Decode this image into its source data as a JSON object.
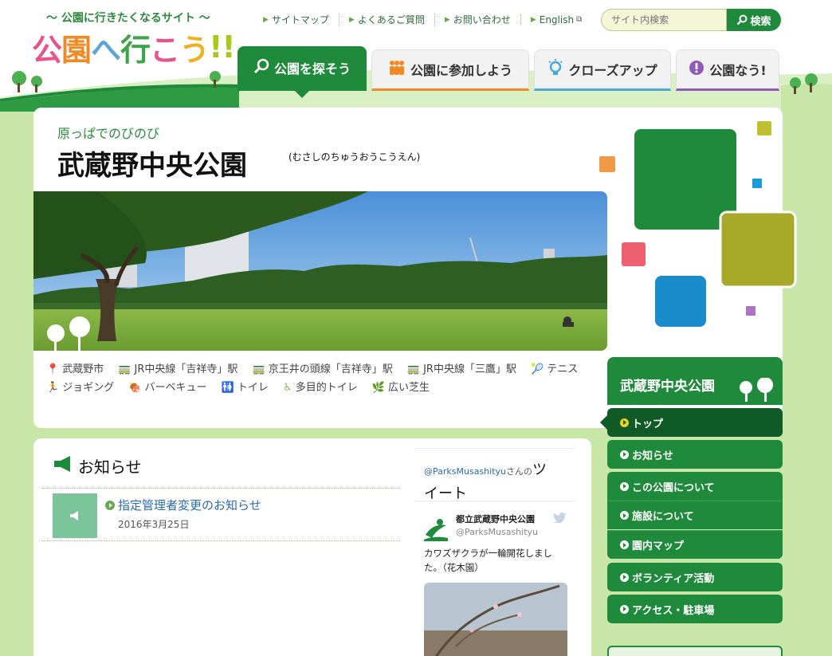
{
  "header": {
    "tagline": "〜 公園に行きたくなるサイト 〜",
    "logo_chars": [
      "公",
      "園",
      "へ",
      "行",
      "こ",
      "う",
      "!!"
    ],
    "util_links": [
      {
        "label": "サイトマップ"
      },
      {
        "label": "よくあるご質問"
      },
      {
        "label": "お問い合わせ"
      },
      {
        "label": "English",
        "external": true
      }
    ],
    "search": {
      "placeholder": "サイト内検索",
      "button": "検索"
    }
  },
  "main_nav": [
    {
      "label": "公園を探そう",
      "icon": "magnifier-icon",
      "active": true
    },
    {
      "label": "公園に参加しよう",
      "icon": "people-icon"
    },
    {
      "label": "クローズアップ",
      "icon": "lightbulb-icon"
    },
    {
      "label": "公園なう!",
      "icon": "exclamation-icon"
    }
  ],
  "park": {
    "catch": "原っぱでのびのび",
    "name": "武蔵野中央公園",
    "reading": "(むさしのちゅうおうこうえん)"
  },
  "tags": [
    {
      "icon": "location-pin-icon",
      "label": "武蔵野市"
    },
    {
      "icon": "train-icon",
      "label": "JR中央線「吉祥寺」駅"
    },
    {
      "icon": "train-icon",
      "label": "京王井の頭線「吉祥寺」駅"
    },
    {
      "icon": "train-icon",
      "label": "JR中央線「三鷹」駅"
    },
    {
      "icon": "tennis-icon",
      "label": "テニス"
    },
    {
      "icon": "jogging-icon",
      "label": "ジョギング"
    },
    {
      "icon": "barbecue-icon",
      "label": "バーベキュー"
    },
    {
      "icon": "toilet-icon",
      "label": "トイレ"
    },
    {
      "icon": "wheelchair-icon",
      "label": "多目的トイレ"
    },
    {
      "icon": "grass-icon",
      "label": "広い芝生"
    }
  ],
  "side_nav": {
    "title": "武蔵野中央公園",
    "items": [
      {
        "label": "トップ",
        "active": true
      },
      {
        "label": "お知らせ"
      },
      {
        "label": "この公園について"
      },
      {
        "label": "施設について"
      },
      {
        "label": "園内マップ"
      },
      {
        "label": "ボランティア活動"
      },
      {
        "label": "アクセス・駐車場"
      }
    ]
  },
  "news": {
    "heading": "お知らせ",
    "items": [
      {
        "title": "指定管理者変更のお知らせ",
        "date": "2016年3月25日"
      }
    ]
  },
  "twitter": {
    "handle": "@ParksMusashityu",
    "suffix": "さんの",
    "title_tail": "ツ",
    "title_line2": "イート",
    "user_name": "都立武蔵野中央公園",
    "user_id": "@ParksMusashityu",
    "text": "カワズザクラが一輪開花しました。（花木園）"
  },
  "colors": {
    "brand_green": "#1f8a3c",
    "dark_green": "#0f5a26",
    "link_blue": "#2a6ab0"
  }
}
